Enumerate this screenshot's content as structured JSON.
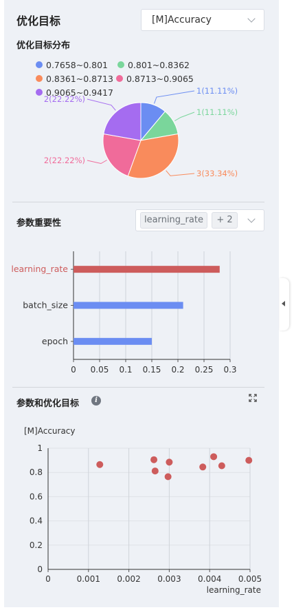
{
  "header": {
    "title": "优化目标",
    "metric_select": "[M]Accuracy"
  },
  "distribution": {
    "title": "优化目标分布",
    "legend": [
      {
        "label": "0.7658~0.801",
        "color": "#6b8df2"
      },
      {
        "label": "0.801~0.8362",
        "color": "#7ad69b"
      },
      {
        "label": "0.8361~0.8713",
        "color": "#f98b5c"
      },
      {
        "label": "0.8713~0.9065",
        "color": "#f06b9a"
      },
      {
        "label": "0.9065~0.9417",
        "color": "#a56cf0"
      }
    ]
  },
  "importance": {
    "title": "参数重要性",
    "tag": "learning_rate",
    "more": "+ 2"
  },
  "scatter_section": {
    "title": "参数和优化目标",
    "info_icon": "info-icon",
    "expand_icon": "expand-icon"
  },
  "chart_data": [
    {
      "type": "pie",
      "labels": [
        "0.7658~0.801",
        "0.801~0.8362",
        "0.8361~0.8713",
        "0.8713~0.9065",
        "0.9065~0.9417"
      ],
      "values": [
        1,
        1,
        3,
        2,
        2
      ],
      "data_labels": [
        "1(11.11%)",
        "1(11.11%)",
        "3(33.34%)",
        "2(22.22%)",
        "2(22.22%)"
      ],
      "colors": [
        "#6b8df2",
        "#7ad69b",
        "#f98b5c",
        "#f06b9a",
        "#a56cf0"
      ]
    },
    {
      "type": "bar",
      "orientation": "horizontal",
      "categories": [
        "learning_rate",
        "batch_size",
        "epoch"
      ],
      "values": [
        0.28,
        0.21,
        0.15
      ],
      "colors": [
        "#cd5c5c",
        "#6b8df2",
        "#6b8df2"
      ],
      "xlim": [
        0,
        0.3
      ],
      "xticks": [
        "0",
        "0.05",
        "0.1",
        "0.15",
        "0.2",
        "0.25",
        "0.3"
      ],
      "xtick_values": [
        0,
        0.05,
        0.1,
        0.15,
        0.2,
        0.25,
        0.3
      ]
    },
    {
      "type": "scatter",
      "ylabel": "[M]Accuracy",
      "xlabel": "learning_rate",
      "xlim": [
        0,
        0.005
      ],
      "ylim": [
        0,
        1
      ],
      "xticks": [
        "0",
        "0.001",
        "0.002",
        "0.003",
        "0.004",
        "0.005"
      ],
      "xtick_values": [
        0,
        0.001,
        0.002,
        0.003,
        0.004,
        0.005
      ],
      "yticks": [
        "0",
        "0.2",
        "0.4",
        "0.6",
        "0.8",
        "1"
      ],
      "ytick_values": [
        0,
        0.2,
        0.4,
        0.6,
        0.8,
        1
      ],
      "color": "#cd5c5c",
      "points": [
        {
          "x": 0.00128,
          "y": 0.865
        },
        {
          "x": 0.00262,
          "y": 0.905
        },
        {
          "x": 0.00265,
          "y": 0.812
        },
        {
          "x": 0.00297,
          "y": 0.765
        },
        {
          "x": 0.003,
          "y": 0.885
        },
        {
          "x": 0.00383,
          "y": 0.845
        },
        {
          "x": 0.0041,
          "y": 0.93
        },
        {
          "x": 0.0043,
          "y": 0.855
        },
        {
          "x": 0.00497,
          "y": 0.9
        }
      ]
    }
  ]
}
